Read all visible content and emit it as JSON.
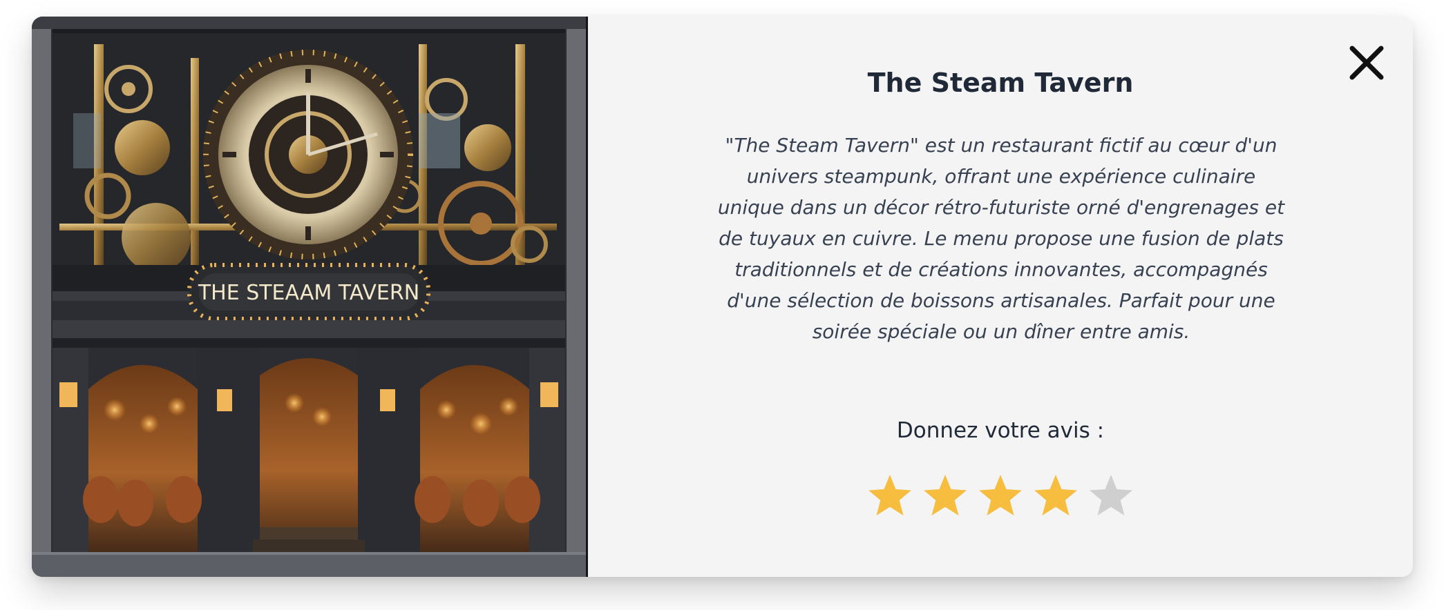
{
  "restaurant": {
    "name": "The Steam Tavern",
    "description": "\"The Steam Tavern\" est un restaurant fictif au cœur d'un univers steampunk, offrant une expérience culinaire unique dans un décor rétro-futuriste orné d'engrenages et de tuyaux en cuivre. Le menu propose une fusion de plats traditionnels et de créations innovantes, accompagnés d'une sélection de boissons artisanales. Parfait pour une soirée spéciale ou un dîner entre amis.",
    "sign_text": "THE STEAAM TAVERN"
  },
  "rating": {
    "label": "Donnez votre avis :",
    "value": 4,
    "max": 5,
    "filled_color": "#f6bd3f",
    "empty_color": "#cfcfcf"
  },
  "close_icon": "close-icon",
  "colors": {
    "modal_background": "#f4f4f5",
    "title_text": "#1f2937"
  }
}
